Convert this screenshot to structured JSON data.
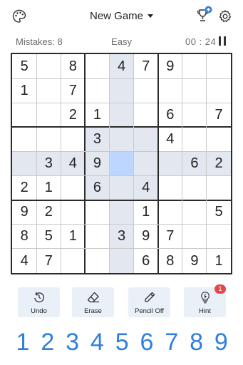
{
  "header": {
    "title": "New Game",
    "icons": [
      "palette-icon",
      "chevron-down-icon",
      "trophy-icon",
      "plus-icon",
      "gear-icon"
    ]
  },
  "status": {
    "mistakes": "Mistakes: 8",
    "difficulty": "Easy",
    "timer": "00 : 24",
    "pause_icon": "pause-icon"
  },
  "board": {
    "rows": [
      [
        "5",
        "",
        "8",
        "",
        "4",
        "7",
        "9",
        "",
        ""
      ],
      [
        "1",
        "",
        "7",
        "",
        "",
        "",
        "",
        "",
        ""
      ],
      [
        "",
        "",
        "2",
        "1",
        "",
        "",
        "6",
        "",
        "7"
      ],
      [
        "",
        "",
        "",
        "3",
        "",
        "",
        "4",
        "",
        ""
      ],
      [
        "",
        "3",
        "4",
        "9",
        "",
        "",
        "",
        "6",
        "2"
      ],
      [
        "2",
        "1",
        "",
        "6",
        "",
        "4",
        "",
        "",
        ""
      ],
      [
        "9",
        "2",
        "",
        "",
        "",
        "1",
        "",
        "",
        "5"
      ],
      [
        "8",
        "5",
        "1",
        "",
        "3",
        "9",
        "7",
        "",
        ""
      ],
      [
        "4",
        "7",
        "",
        "",
        "",
        "6",
        "8",
        "9",
        "1"
      ]
    ],
    "selected_row": 4,
    "selected_col": 4,
    "highlight_color": "#e3e8f0",
    "selected_color": "#bcd6ff"
  },
  "tools": {
    "undo": "Undo",
    "erase": "Erase",
    "pencil": "Pencil Off",
    "hint": "Hint",
    "hint_badge": "1"
  },
  "numpad": [
    "1",
    "2",
    "3",
    "4",
    "5",
    "6",
    "7",
    "8",
    "9"
  ],
  "colors": {
    "accent": "#2f7fde",
    "badge": "#e24a4a"
  }
}
